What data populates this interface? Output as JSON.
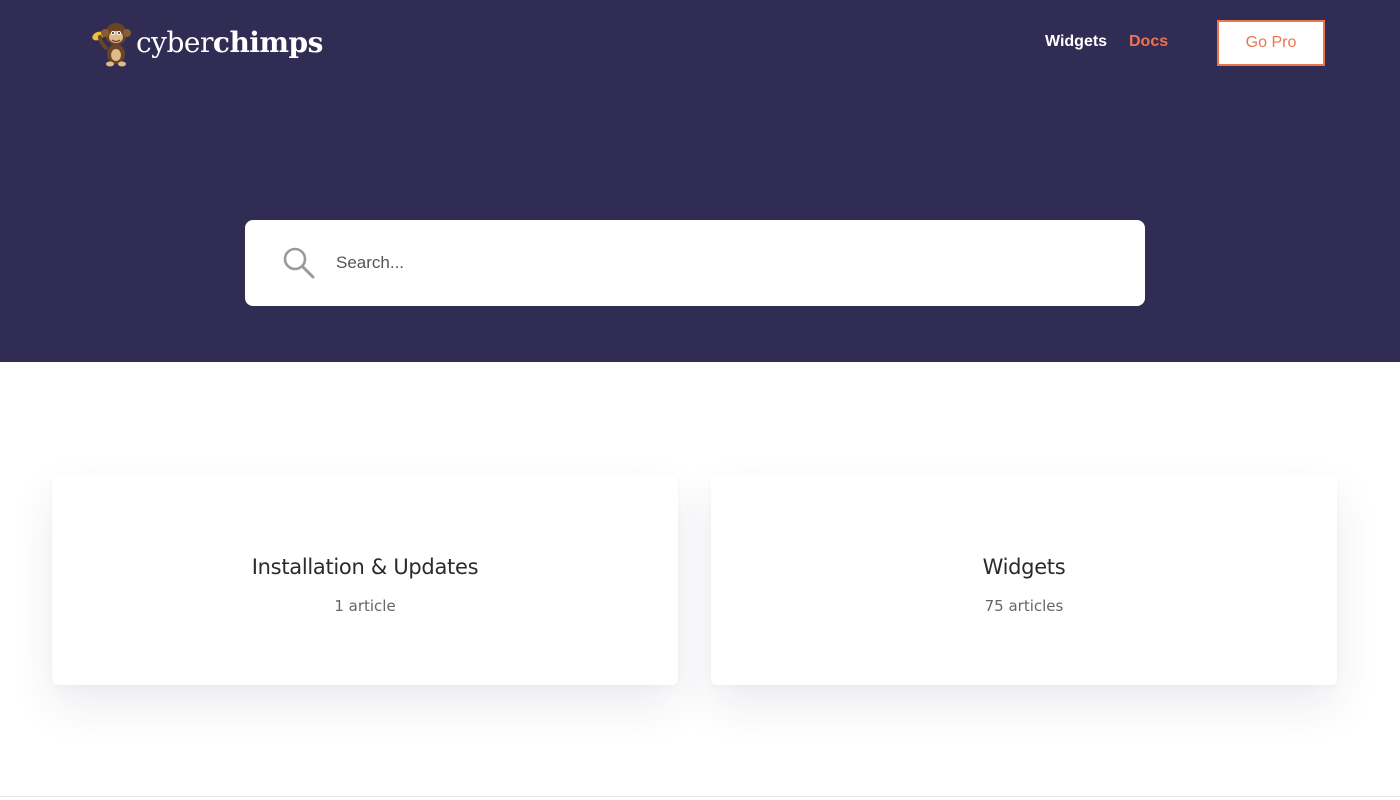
{
  "header": {
    "logo": {
      "text_light": "cyber",
      "text_bold": "chimps"
    },
    "nav": [
      {
        "label": "Widgets"
      },
      {
        "label": "Docs"
      }
    ],
    "cta_label": "Go Pro"
  },
  "search": {
    "placeholder": "Search..."
  },
  "categories": [
    {
      "title": "Installation & Updates",
      "count": "1 article"
    },
    {
      "title": "Widgets",
      "count": "75 articles"
    }
  ],
  "colors": {
    "hero_bg": "#302c54",
    "accent": "#f2724e",
    "white": "#ffffff"
  }
}
